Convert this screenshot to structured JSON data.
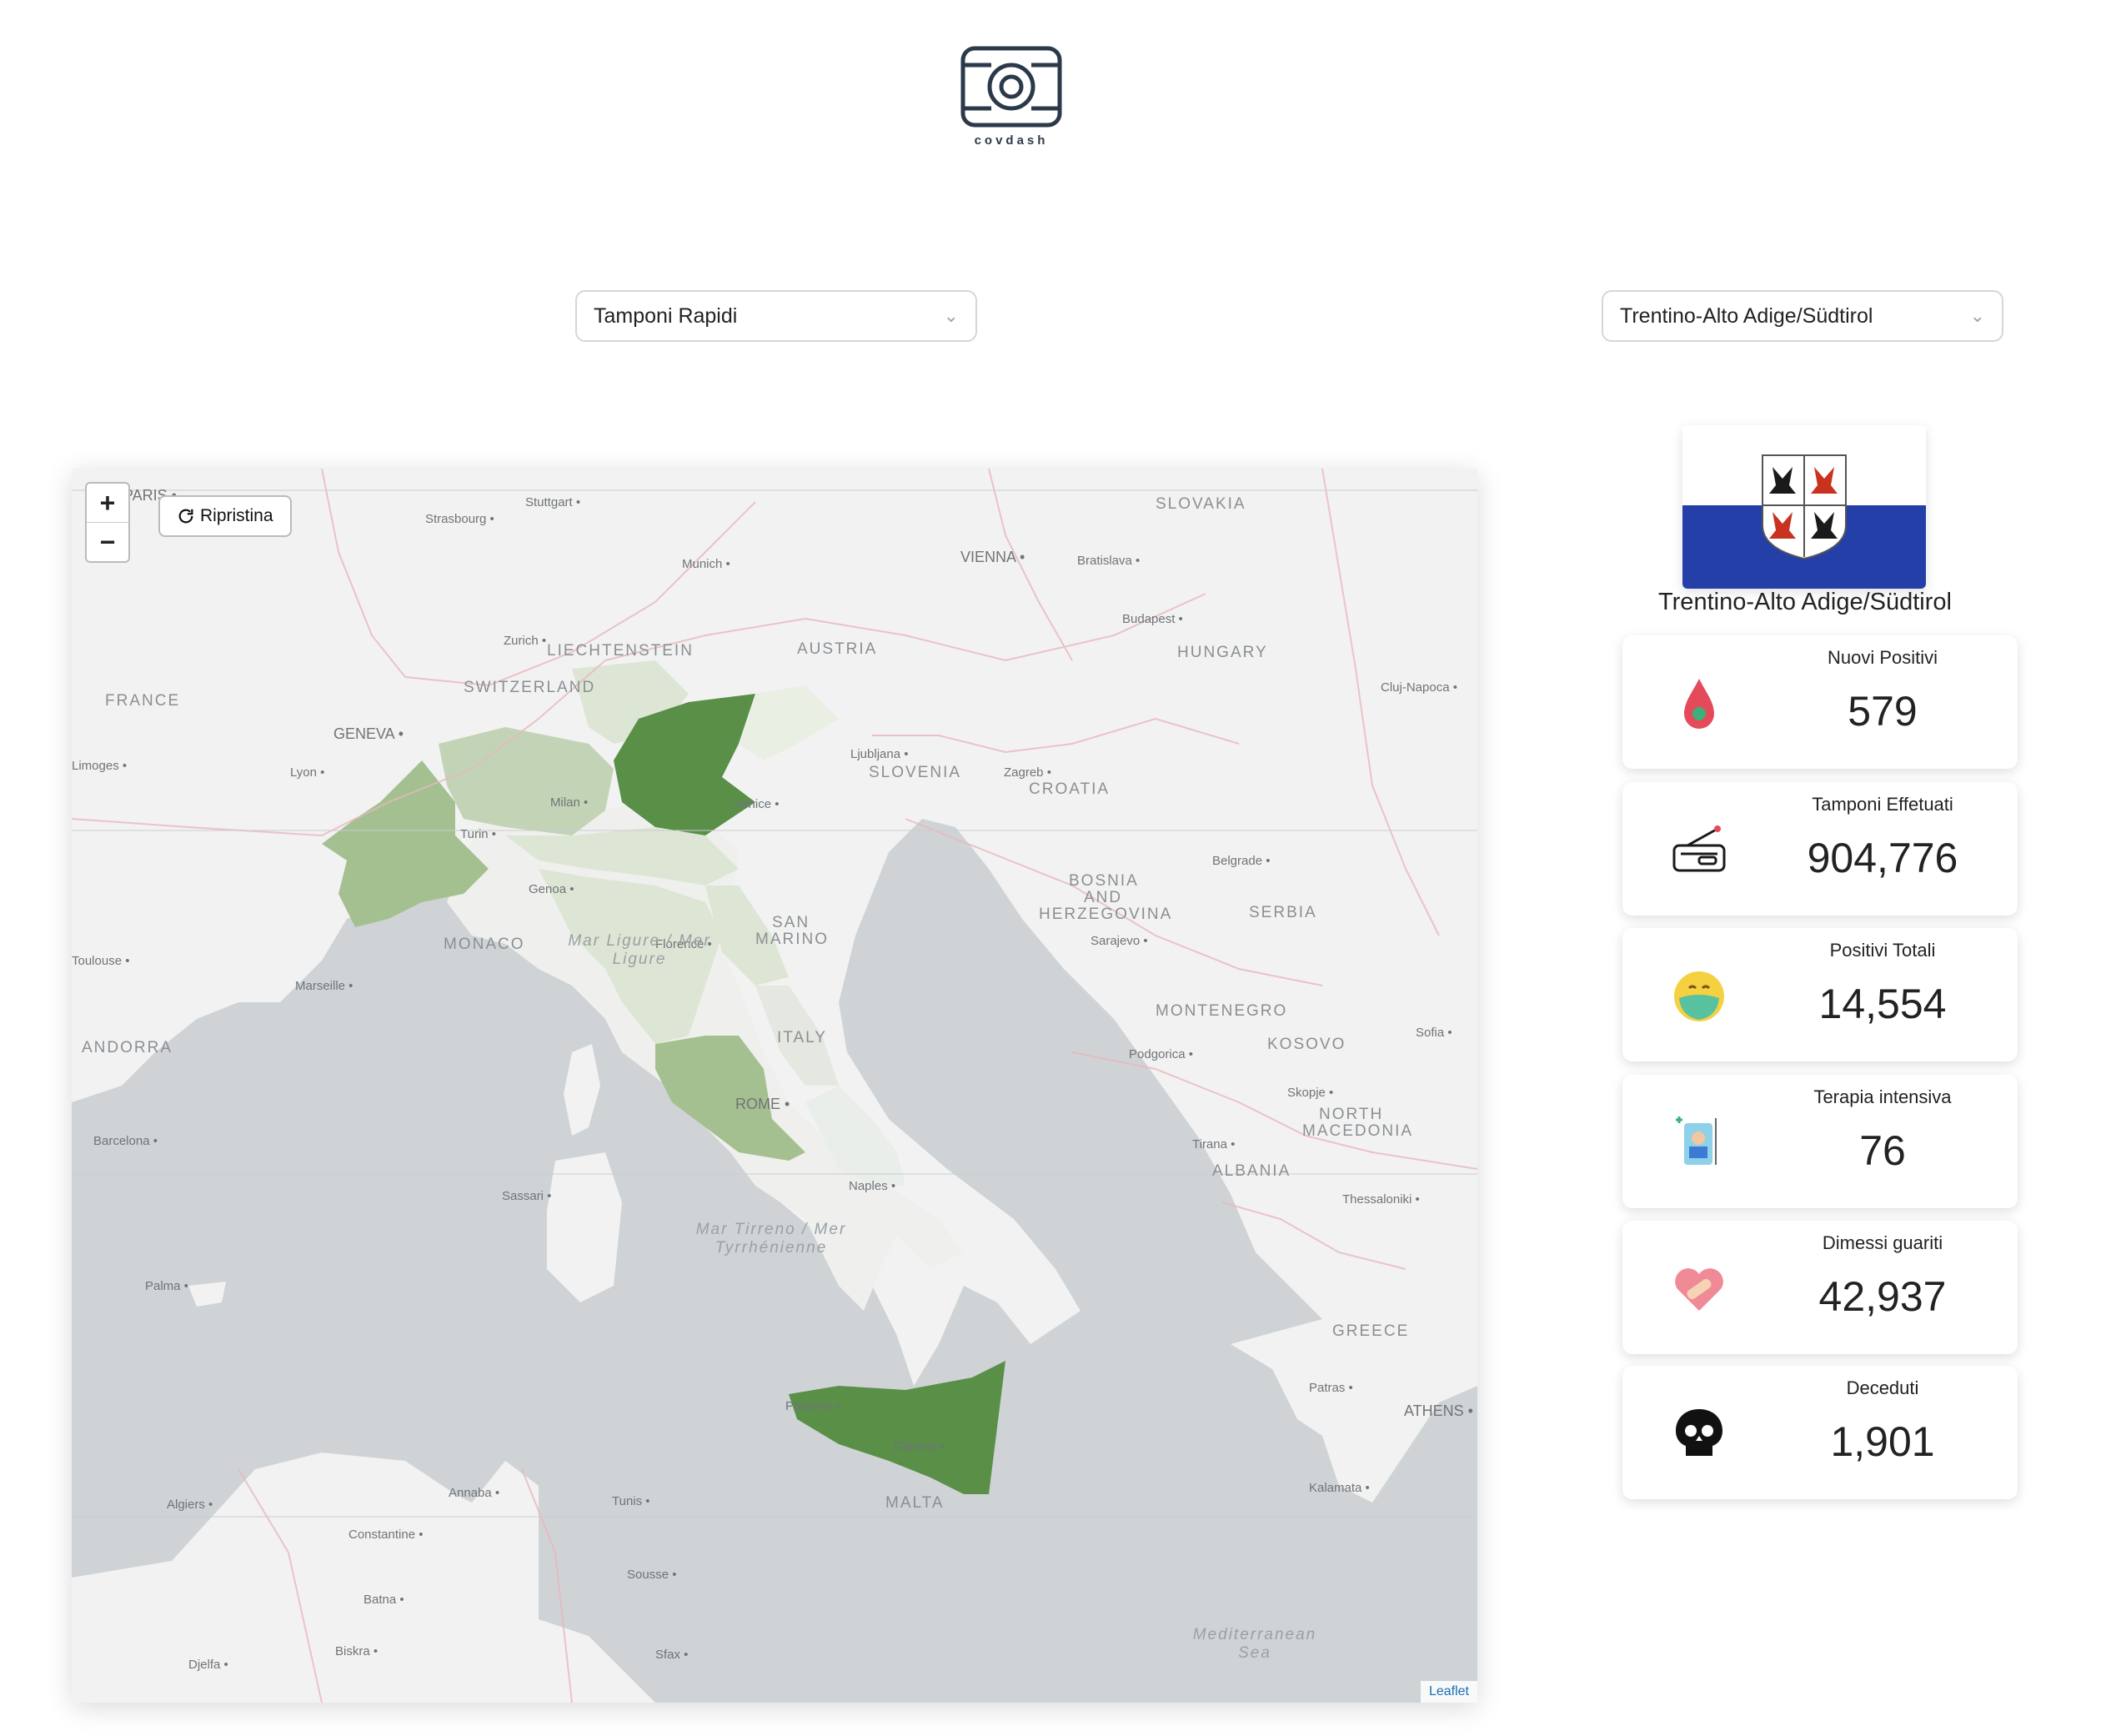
{
  "brand": {
    "name": "covdash"
  },
  "selects": {
    "metric": {
      "value": "Tamponi Rapidi"
    },
    "region": {
      "value": "Trentino-Alto Adige/Südtirol"
    }
  },
  "map": {
    "reset_label": "Ripristina",
    "zoom_in": "+",
    "zoom_out": "−",
    "attribution": "Leaflet",
    "country_labels": [
      "FRANCE",
      "SWITZERLAND",
      "LIECHTENSTEIN",
      "AUSTRIA",
      "SLOVAKIA",
      "HUNGARY",
      "SLOVENIA",
      "CROATIA",
      "BOSNIA",
      "AND",
      "HERZEGOVINA",
      "SERBIA",
      "MONTENEGRO",
      "KOSOVO",
      "NORTH",
      "MACEDONIA",
      "ALBANIA",
      "GREECE",
      "MONACO",
      "ANDORRA",
      "SAN",
      "MARINO",
      "ITALY",
      "MALTA"
    ],
    "city_labels": [
      "PARIS",
      "Stuttgart",
      "Strasbourg",
      "Munich",
      "VIENNA",
      "Bratislava",
      "Budapest",
      "Zurich",
      "GENEVA",
      "Lyon",
      "Limoges",
      "Cluj-Napoca",
      "Ljubljana",
      "Zagreb",
      "Milan",
      "Turin",
      "Venice",
      "Genoa",
      "Florence",
      "Toulouse",
      "Marseille",
      "Belgrade",
      "Sarajevo",
      "Sofia",
      "Podgorica",
      "Skopje",
      "Tirana",
      "Thessaloniki",
      "ROME",
      "Naples",
      "Sassari",
      "Barcelona",
      "Palma",
      "Palermo",
      "Catania",
      "Tunis",
      "Algiers",
      "Annaba",
      "Constantine",
      "Sousse",
      "Batna",
      "Biskra",
      "Djelfa",
      "Sfax",
      "Patras",
      "ATHENS",
      "Kalamata"
    ],
    "sea_labels": [
      "Mar Ligure / Mer Ligure",
      "Mar Tirreno / Mer Tyrrhénienne",
      "Mediterranean Sea"
    ],
    "colors": {
      "sea": "#cfd3d6",
      "land": "#f2f2f2",
      "border": "#e8b7bd",
      "light_green": "#dde6d4",
      "mid_green": "#a4c090",
      "dark_green": "#5a8f48"
    }
  },
  "region_card": {
    "name": "Trentino-Alto Adige/Südtirol",
    "flag_colors": {
      "top": "#ffffff",
      "bottom": "#2440a8"
    }
  },
  "stats": [
    {
      "label": "Nuovi Positivi",
      "value": "579",
      "icon": "blood-drop-icon"
    },
    {
      "label": "Tamponi Effetuati",
      "value": "904,776",
      "icon": "test-kit-icon"
    },
    {
      "label": "Positivi Totali",
      "value": "14,554",
      "icon": "masked-face-icon"
    },
    {
      "label": "Terapia intensiva",
      "value": "76",
      "icon": "icu-icon"
    },
    {
      "label": "Dimessi guariti",
      "value": "42,937",
      "icon": "healed-heart-icon"
    },
    {
      "label": "Deceduti",
      "value": "1,901",
      "icon": "skull-icon"
    }
  ]
}
